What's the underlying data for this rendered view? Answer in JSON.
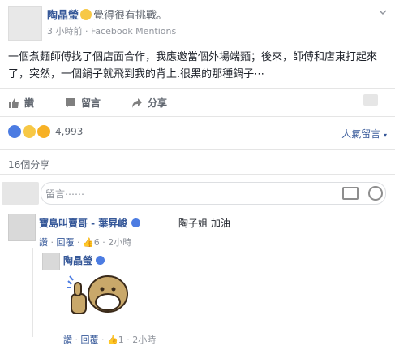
{
  "post": {
    "author": "陶晶瑩",
    "feeling": "覺得很有挑戰。",
    "time": "3 小時前",
    "separator": "·",
    "source": "Facebook Mentions",
    "text": "一個煮麵師傅找了個店面合作，我應邀當個外場端麵；後來，師傅和店東打起來了，突然，一個鍋子就飛到我的背上.很黑的那種鍋子⋯"
  },
  "actions": {
    "like": "讚",
    "comment": "留言",
    "share": "分享"
  },
  "reactions": {
    "count": "4,993",
    "sort_label": "人氣留言",
    "shares": "16個分享"
  },
  "comment_input": {
    "placeholder": "留言⋯⋯"
  },
  "comments": [
    {
      "author": "寶島叫賣哥 - 葉昇峻",
      "text": "陶子姐 加油",
      "like_label": "讚",
      "reply_label": "回覆",
      "likes": "6",
      "time": "2小時"
    },
    {
      "author": "陶晶瑩",
      "like_label": "讚",
      "reply_label": "回覆",
      "likes": "1",
      "time": "2小時"
    }
  ]
}
